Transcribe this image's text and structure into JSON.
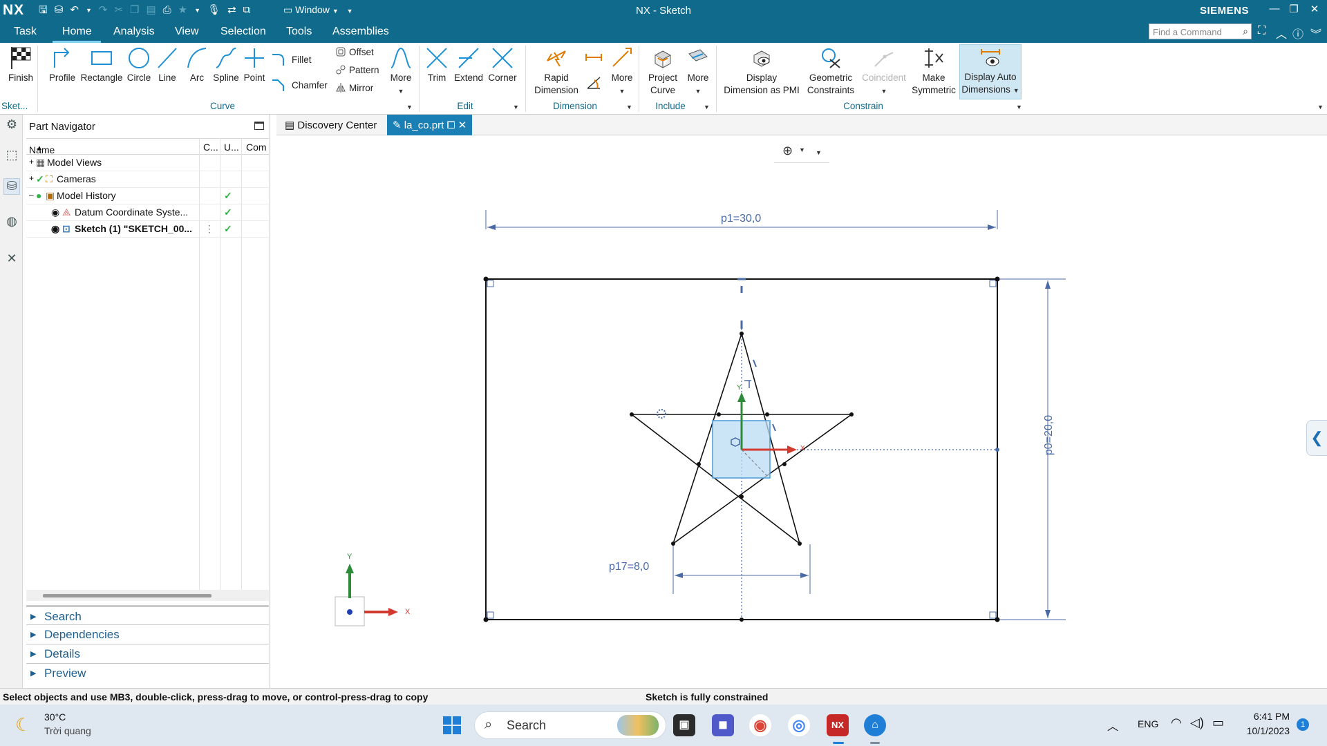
{
  "titlebar": {
    "logo": "NX",
    "window_menu": "Window",
    "title": "NX - Sketch",
    "brand": "SIEMENS",
    "minimize": "—",
    "restore": "❐",
    "close": "✕"
  },
  "tabs": {
    "task": "Task",
    "home": "Home",
    "analysis": "Analysis",
    "view": "View",
    "selection": "Selection",
    "tools": "Tools",
    "assemblies": "Assemblies",
    "find_placeholder": "Find a Command"
  },
  "ribbon": {
    "finish": "Finish",
    "sketch_group": "Sket...",
    "profile": "Profile",
    "rectangle": "Rectangle",
    "circle": "Circle",
    "line": "Line",
    "arc": "Arc",
    "spline": "Spline",
    "point": "Point",
    "fillet": "Fillet",
    "chamfer": "Chamfer",
    "offset": "Offset",
    "pattern": "Pattern",
    "mirror": "Mirror",
    "more_curve": "More",
    "curve_group": "Curve",
    "trim": "Trim",
    "extend": "Extend",
    "corner": "Corner",
    "edit_group": "Edit",
    "rapid_dimension_1": "Rapid",
    "rapid_dimension_2": "Dimension",
    "more_dimension": "More",
    "dimension_group": "Dimension",
    "project_curve_1": "Project",
    "project_curve_2": "Curve",
    "more_include": "More",
    "include_group": "Include",
    "display_dim_pmi_1": "Display",
    "display_dim_pmi_2": "Dimension as PMI",
    "geometric_constraints_1": "Geometric",
    "geometric_constraints_2": "Constraints",
    "coincident": "Coincident",
    "make_symmetric_1": "Make",
    "make_symmetric_2": "Symmetric",
    "display_auto_dims_1": "Display Auto",
    "display_auto_dims_2": "Dimensions",
    "constrain_group": "Constrain"
  },
  "part_navigator": {
    "title": "Part Navigator",
    "columns": {
      "name": "Name",
      "c": "C...",
      "u": "U...",
      "com": "Com"
    },
    "rows": [
      {
        "label": "Model Views",
        "expander": "+"
      },
      {
        "label": "Cameras",
        "expander": "+"
      },
      {
        "label": "Model History",
        "expander": "–"
      },
      {
        "label": "Datum Coordinate Syste..."
      },
      {
        "label": "Sketch (1) \"SKETCH_00..."
      }
    ],
    "sections": [
      "Search",
      "Dependencies",
      "Details",
      "Preview"
    ]
  },
  "doc_tabs": {
    "discovery": "Discovery Center",
    "part": "la_co.prt"
  },
  "canvas": {
    "dim_width": "p1=30,0",
    "dim_height": "p0=20,0",
    "dim_star": "p17=8,0",
    "axis_x": "X",
    "axis_y": "Y"
  },
  "status": {
    "left": "Select objects and use MB3, double-click, press-drag to move, or control-press-drag to copy",
    "center": "Sketch is fully constrained"
  },
  "taskbar": {
    "temperature": "30°C",
    "weather": "Trời quang",
    "search": "Search",
    "language": "ENG",
    "time": "6:41 PM",
    "date": "10/1/2023",
    "notifications": "1"
  },
  "colors": {
    "titlebar": "#0f6a8b",
    "dimension_blue": "#4a6aa6",
    "check_green": "#2fb24a",
    "active_tab": "#1a7fb5"
  }
}
